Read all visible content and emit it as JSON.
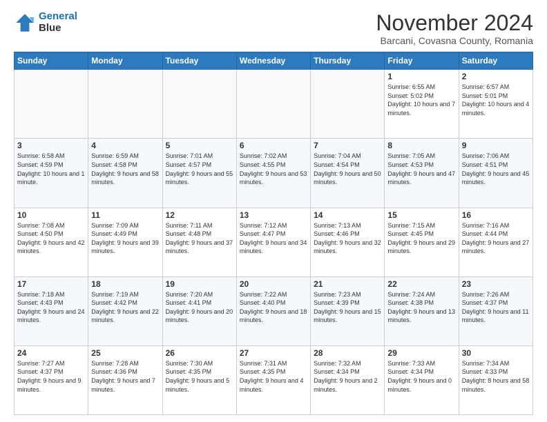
{
  "header": {
    "logo_line1": "General",
    "logo_line2": "Blue",
    "title": "November 2024",
    "subtitle": "Barcani, Covasna County, Romania"
  },
  "weekdays": [
    "Sunday",
    "Monday",
    "Tuesday",
    "Wednesday",
    "Thursday",
    "Friday",
    "Saturday"
  ],
  "weeks": [
    [
      {
        "day": "",
        "info": ""
      },
      {
        "day": "",
        "info": ""
      },
      {
        "day": "",
        "info": ""
      },
      {
        "day": "",
        "info": ""
      },
      {
        "day": "",
        "info": ""
      },
      {
        "day": "1",
        "info": "Sunrise: 6:55 AM\nSunset: 5:02 PM\nDaylight: 10 hours and 7 minutes."
      },
      {
        "day": "2",
        "info": "Sunrise: 6:57 AM\nSunset: 5:01 PM\nDaylight: 10 hours and 4 minutes."
      }
    ],
    [
      {
        "day": "3",
        "info": "Sunrise: 6:58 AM\nSunset: 4:59 PM\nDaylight: 10 hours and 1 minute."
      },
      {
        "day": "4",
        "info": "Sunrise: 6:59 AM\nSunset: 4:58 PM\nDaylight: 9 hours and 58 minutes."
      },
      {
        "day": "5",
        "info": "Sunrise: 7:01 AM\nSunset: 4:57 PM\nDaylight: 9 hours and 55 minutes."
      },
      {
        "day": "6",
        "info": "Sunrise: 7:02 AM\nSunset: 4:55 PM\nDaylight: 9 hours and 53 minutes."
      },
      {
        "day": "7",
        "info": "Sunrise: 7:04 AM\nSunset: 4:54 PM\nDaylight: 9 hours and 50 minutes."
      },
      {
        "day": "8",
        "info": "Sunrise: 7:05 AM\nSunset: 4:53 PM\nDaylight: 9 hours and 47 minutes."
      },
      {
        "day": "9",
        "info": "Sunrise: 7:06 AM\nSunset: 4:51 PM\nDaylight: 9 hours and 45 minutes."
      }
    ],
    [
      {
        "day": "10",
        "info": "Sunrise: 7:08 AM\nSunset: 4:50 PM\nDaylight: 9 hours and 42 minutes."
      },
      {
        "day": "11",
        "info": "Sunrise: 7:09 AM\nSunset: 4:49 PM\nDaylight: 9 hours and 39 minutes."
      },
      {
        "day": "12",
        "info": "Sunrise: 7:11 AM\nSunset: 4:48 PM\nDaylight: 9 hours and 37 minutes."
      },
      {
        "day": "13",
        "info": "Sunrise: 7:12 AM\nSunset: 4:47 PM\nDaylight: 9 hours and 34 minutes."
      },
      {
        "day": "14",
        "info": "Sunrise: 7:13 AM\nSunset: 4:46 PM\nDaylight: 9 hours and 32 minutes."
      },
      {
        "day": "15",
        "info": "Sunrise: 7:15 AM\nSunset: 4:45 PM\nDaylight: 9 hours and 29 minutes."
      },
      {
        "day": "16",
        "info": "Sunrise: 7:16 AM\nSunset: 4:44 PM\nDaylight: 9 hours and 27 minutes."
      }
    ],
    [
      {
        "day": "17",
        "info": "Sunrise: 7:18 AM\nSunset: 4:43 PM\nDaylight: 9 hours and 24 minutes."
      },
      {
        "day": "18",
        "info": "Sunrise: 7:19 AM\nSunset: 4:42 PM\nDaylight: 9 hours and 22 minutes."
      },
      {
        "day": "19",
        "info": "Sunrise: 7:20 AM\nSunset: 4:41 PM\nDaylight: 9 hours and 20 minutes."
      },
      {
        "day": "20",
        "info": "Sunrise: 7:22 AM\nSunset: 4:40 PM\nDaylight: 9 hours and 18 minutes."
      },
      {
        "day": "21",
        "info": "Sunrise: 7:23 AM\nSunset: 4:39 PM\nDaylight: 9 hours and 15 minutes."
      },
      {
        "day": "22",
        "info": "Sunrise: 7:24 AM\nSunset: 4:38 PM\nDaylight: 9 hours and 13 minutes."
      },
      {
        "day": "23",
        "info": "Sunrise: 7:26 AM\nSunset: 4:37 PM\nDaylight: 9 hours and 11 minutes."
      }
    ],
    [
      {
        "day": "24",
        "info": "Sunrise: 7:27 AM\nSunset: 4:37 PM\nDaylight: 9 hours and 9 minutes."
      },
      {
        "day": "25",
        "info": "Sunrise: 7:28 AM\nSunset: 4:36 PM\nDaylight: 9 hours and 7 minutes."
      },
      {
        "day": "26",
        "info": "Sunrise: 7:30 AM\nSunset: 4:35 PM\nDaylight: 9 hours and 5 minutes."
      },
      {
        "day": "27",
        "info": "Sunrise: 7:31 AM\nSunset: 4:35 PM\nDaylight: 9 hours and 4 minutes."
      },
      {
        "day": "28",
        "info": "Sunrise: 7:32 AM\nSunset: 4:34 PM\nDaylight: 9 hours and 2 minutes."
      },
      {
        "day": "29",
        "info": "Sunrise: 7:33 AM\nSunset: 4:34 PM\nDaylight: 9 hours and 0 minutes."
      },
      {
        "day": "30",
        "info": "Sunrise: 7:34 AM\nSunset: 4:33 PM\nDaylight: 8 hours and 58 minutes."
      }
    ]
  ]
}
